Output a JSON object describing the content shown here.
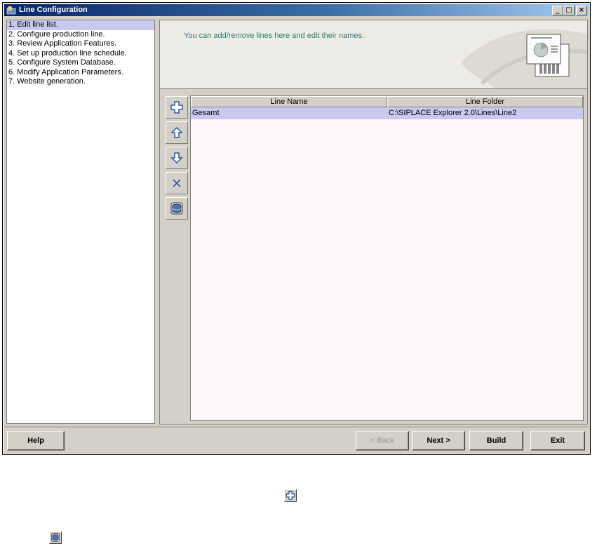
{
  "window": {
    "title": "Line Configuration"
  },
  "steps": [
    "1. Edit line list.",
    "2. Configure production line.",
    "3. Review Application Features.",
    "4. Set up production line schedule.",
    "5. Configure System Database.",
    "6. Modify Application Parameters.",
    "7. Website generation."
  ],
  "banner": {
    "text": "You can add/remove lines here and edit their names."
  },
  "table": {
    "columns": [
      "Line Name",
      "Line Folder"
    ],
    "rows": [
      {
        "name": "Gesamt",
        "folder": "C:\\SIPLACE Explorer 2.0\\Lines\\Line2"
      }
    ]
  },
  "buttons": {
    "help": "Help",
    "back": "< Back",
    "next": "Next >",
    "build": "Build",
    "exit": "Exit"
  },
  "icons": {
    "add": "add-icon",
    "up": "arrow-up-icon",
    "down": "arrow-down-icon",
    "delete": "delete-icon",
    "database": "database-icon"
  }
}
